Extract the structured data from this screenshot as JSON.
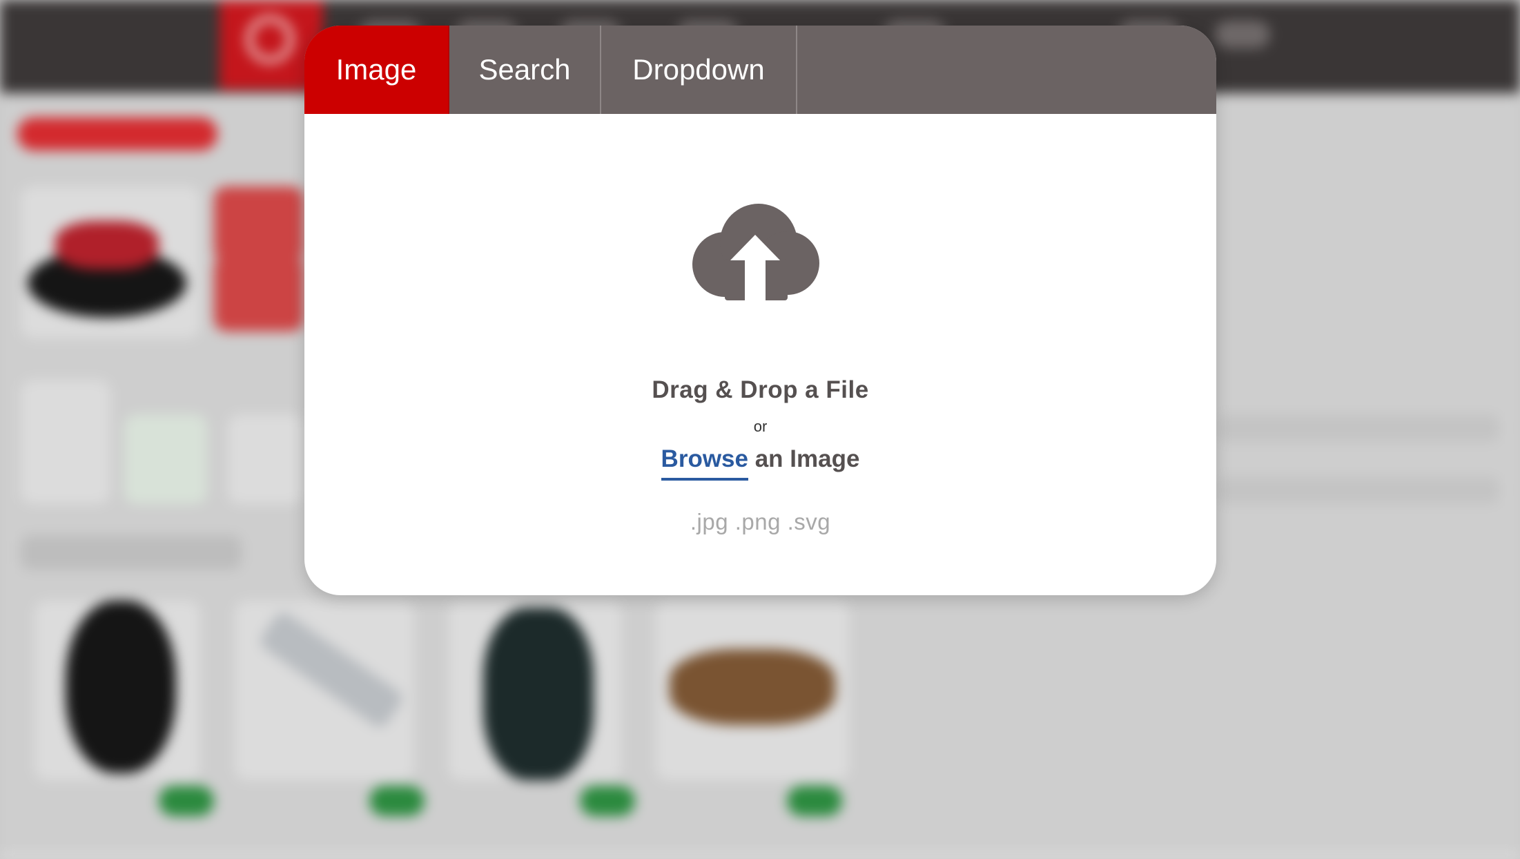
{
  "modal": {
    "tabs": [
      {
        "label": "Image",
        "active": true
      },
      {
        "label": "Search",
        "active": false
      },
      {
        "label": "Dropdown",
        "active": false
      }
    ],
    "upload": {
      "icon": "cloud-upload-icon",
      "drag_text": "Drag & Drop a File",
      "or_text": "or",
      "browse_link": "Browse",
      "browse_suffix": " an Image",
      "formats": ".jpg .png .svg"
    }
  },
  "colors": {
    "active_tab": "#cc0000",
    "tab_bar": "#6b6363",
    "link": "#2a5aa0",
    "icon": "#6b6363"
  }
}
